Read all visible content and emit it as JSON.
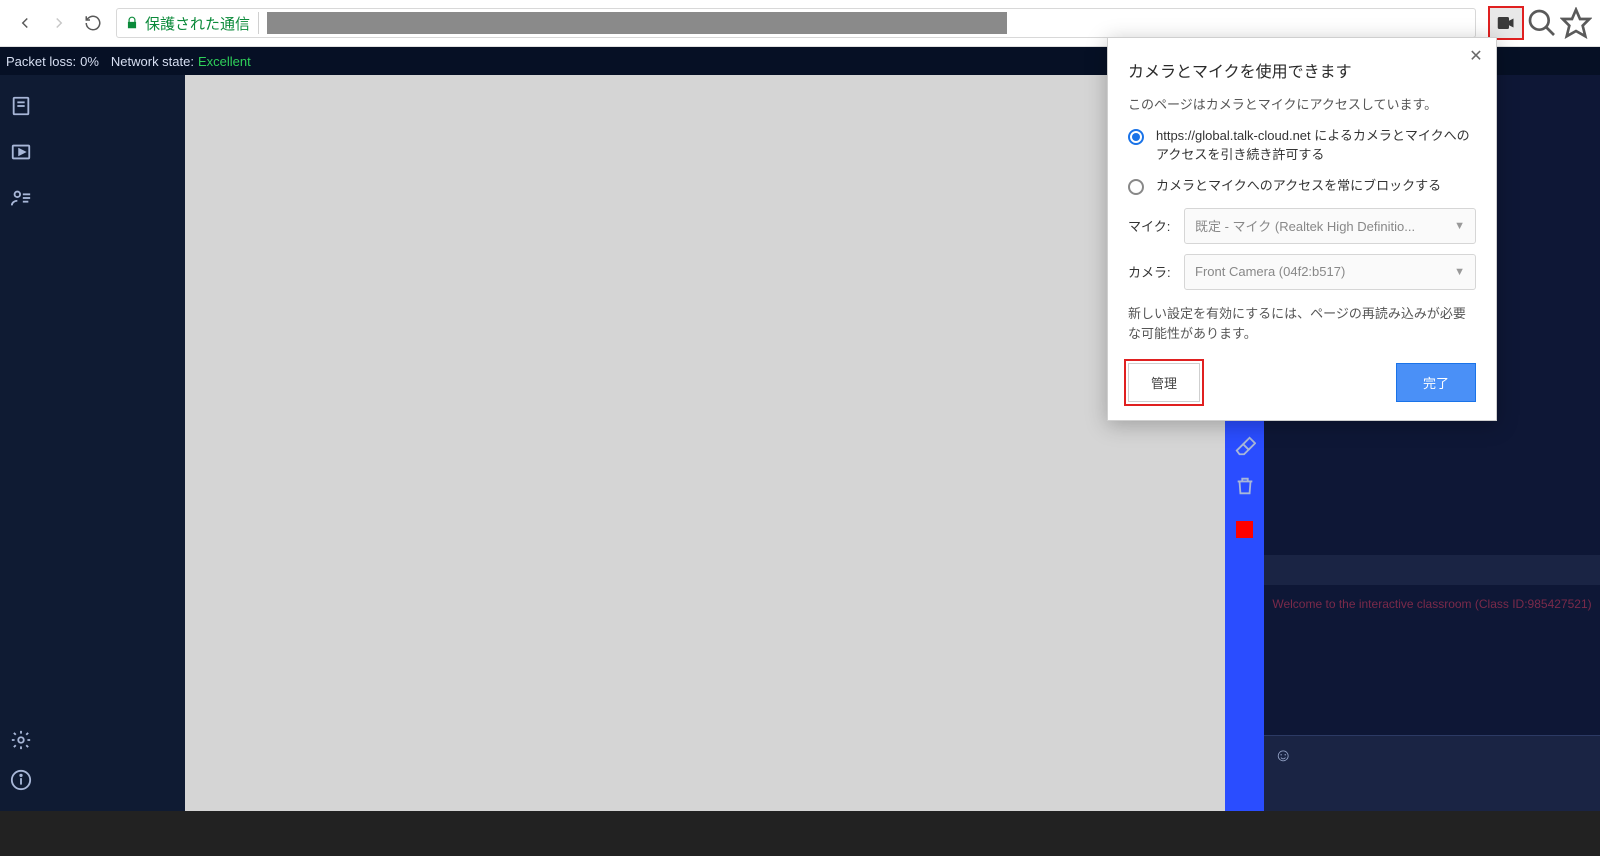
{
  "chrome": {
    "secure_label": "保護された通信"
  },
  "app": {
    "status": {
      "packet_loss_label": "Packet loss:",
      "packet_loss_value": "0%",
      "network_state_label": "Network state:",
      "network_state_value": "Excellent"
    },
    "welcome": "Welcome to the  interactive classroom   (Class ID:985427521)"
  },
  "popup": {
    "title": "カメラとマイクを使用できます",
    "description": "このページはカメラとマイクにアクセスしています。",
    "option_allow": "https://global.talk-cloud.net によるカメラとマイクへのアクセスを引き続き許可する",
    "option_block": "カメラとマイクへのアクセスを常にブロックする",
    "mic_label": "マイク:",
    "mic_value": "既定 - マイク (Realtek High Definitio...",
    "camera_label": "カメラ:",
    "camera_value": "Front Camera (04f2:b517)",
    "note": "新しい設定を有効にするには、ページの再読み込みが必要な可能性があります。",
    "manage_label": "管理",
    "done_label": "完了"
  }
}
